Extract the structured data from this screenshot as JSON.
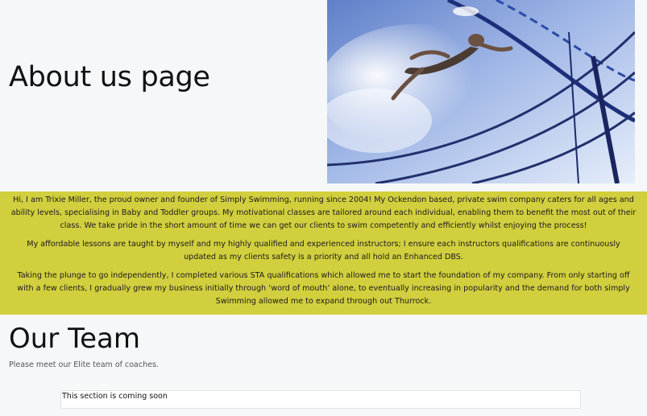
{
  "hero": {
    "title": "About us page",
    "image": "swimmer-in-pool-photo"
  },
  "about": {
    "paragraphs": [
      "Hi, I am Trixie Miller, the proud owner and founder of Simply Swimming, running since 2004! My Ockendon based, private swim company caters for all ages and ability levels, specialising in Baby and Toddler groups. My motivational classes are tailored around each individual, enabling them to benefit the most out of their class. We take pride in the short amount of time we can get our clients to swim competently and efficiently whilst enjoying the process!",
      "My affordable lessons are taught by myself and my highly qualified and experienced instructors; I ensure each instructors qualifications are continuously updated as my clients safety is a priority and all hold an Enhanced DBS.",
      "Taking the plunge to go independently, I completed various STA qualifications which allowed me to start the foundation of my company. From only starting off with a few clients, I gradually grew my business initially through ‘word of mouth’ alone, to eventually increasing in popularity and the demand for both simply Swimming allowed me to expand through out Thurrock."
    ],
    "background_color": "#d2cf3f"
  },
  "team": {
    "title": "Our Team",
    "subtitle": "Please meet our Elite team of coaches.",
    "placeholder_text": "This section is coming soon"
  }
}
